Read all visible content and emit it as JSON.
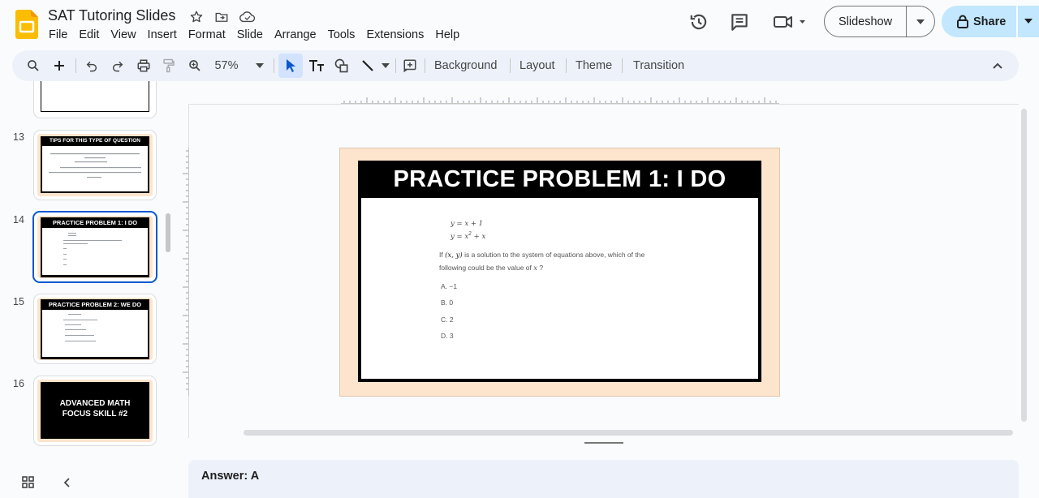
{
  "app": {
    "doc_title": "SAT Tutoring Slides",
    "menus": [
      "File",
      "Edit",
      "View",
      "Insert",
      "Format",
      "Slide",
      "Arrange",
      "Tools",
      "Extensions",
      "Help"
    ],
    "slideshow_label": "Slideshow",
    "share_label": "Share"
  },
  "toolbar": {
    "zoom": "57%",
    "background_label": "Background",
    "layout_label": "Layout",
    "theme_label": "Theme",
    "transition_label": "Transition"
  },
  "filmstrip": {
    "slides": [
      {
        "number": "13",
        "title": "TIPS FOR THIS TYPE OF QUESTION"
      },
      {
        "number": "14",
        "title": "PRACTICE PROBLEM 1: I DO"
      },
      {
        "number": "15",
        "title": "PRACTICE PROBLEM 2: WE DO"
      },
      {
        "number": "16",
        "title": "ADVANCED MATH FOCUS SKILL #2"
      }
    ]
  },
  "slide": {
    "title": "PRACTICE PROBLEM 1: I DO",
    "eq1": "y = x + 1",
    "eq2_base": "y = x",
    "eq2_exp": "2",
    "eq2_tail": " + x",
    "question_pre": "If ",
    "question_xy": "(x, y)",
    "question_post": " is a solution to the system of equations above, which of the",
    "question_line2": "following could be the value of ",
    "question_var": "x",
    "question_end": " ?",
    "choices": [
      "A. −1",
      "B. 0",
      "C. 2",
      "D. 3"
    ]
  },
  "notes": {
    "text": "Answer: A"
  },
  "colors": {
    "accent": "#0b57d0",
    "share_bg": "#c2e7ff",
    "slide_bg": "#fde4cc"
  }
}
